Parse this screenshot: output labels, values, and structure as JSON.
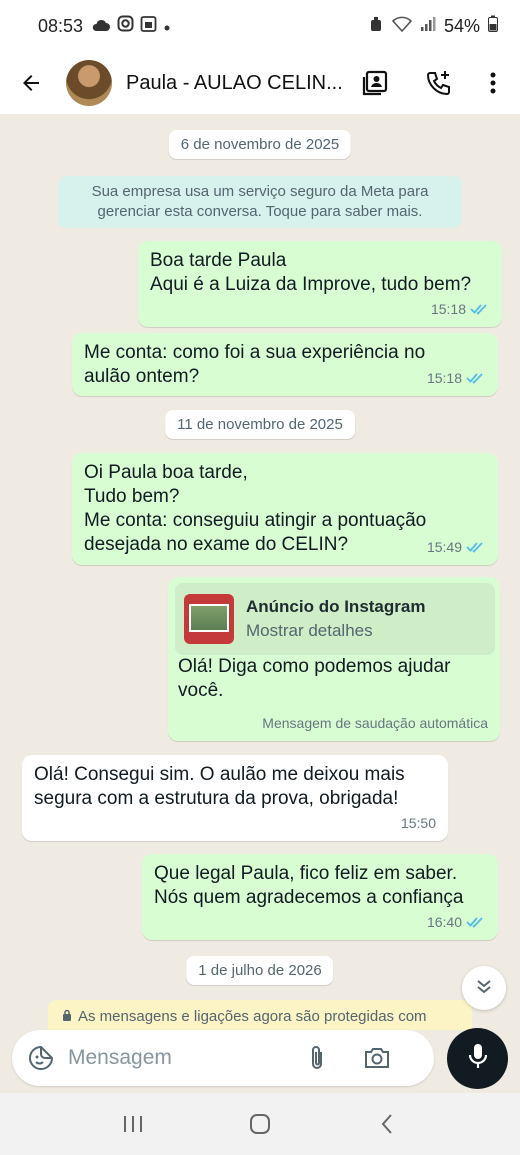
{
  "status_bar": {
    "time": "08:53",
    "battery": "54%",
    "icons": [
      "cloud-icon",
      "instagram-icon",
      "calendar-icon",
      "dot-icon",
      "alarm-icon",
      "wifi-icon",
      "signal-icon",
      "battery-icon"
    ]
  },
  "header": {
    "contact_name": "Paula - AULAO CELIN...",
    "icons": [
      "back-arrow-icon",
      "contact-card-icon",
      "add-call-icon",
      "more-vert-icon"
    ]
  },
  "chat": {
    "date_1": "6 de novembro de 2025",
    "system_notice": "Sua empresa usa um serviço seguro da Meta para gerenciar esta conversa. Toque para saber mais.",
    "messages": [
      {
        "text": "Boa tarde Paula\nAqui é a Luiza da Improve, tudo bem?",
        "time": "15:18",
        "direction": "out",
        "read": true
      },
      {
        "text": "Me conta: como foi a sua experiência no aulão ontem?",
        "time": "15:18",
        "direction": "out",
        "read": true
      },
      {
        "text": "Oi Paula boa tarde,\nTudo bem?\nMe conta: conseguiu atingir a pontuação desejada no exame do CELIN?",
        "time": "15:49",
        "direction": "out",
        "read": true
      },
      {
        "text": "Olá! Diga como podemos ajudar você.",
        "time": "Mensagem de saudação automática",
        "direction": "out",
        "read": false
      },
      {
        "text": "Olá! Consegui sim. O aulão me deixou mais segura com a estrutura da prova, obrigada!",
        "time": "15:50",
        "direction": "in",
        "read": false
      },
      {
        "text": "Que legal Paula, fico feliz em saber.\nNós quem agradecemos a confiança",
        "time": "16:40",
        "direction": "out",
        "read": true
      }
    ],
    "date_2": "11 de novembro de 2025",
    "date_3": "1 de julho de 2026",
    "ad_card": {
      "title": "Anúncio do Instagram",
      "subtitle": "Mostrar detalhes"
    },
    "encryption_notice": "As mensagens e ligações agora são protegidas com"
  },
  "composer": {
    "placeholder": "Mensagem"
  },
  "colors": {
    "outgoing_bubble": "#d9fdd3",
    "incoming_bubble": "#ffffff",
    "chat_background": "#efeae2",
    "read_ticks": "#53bdeb"
  }
}
